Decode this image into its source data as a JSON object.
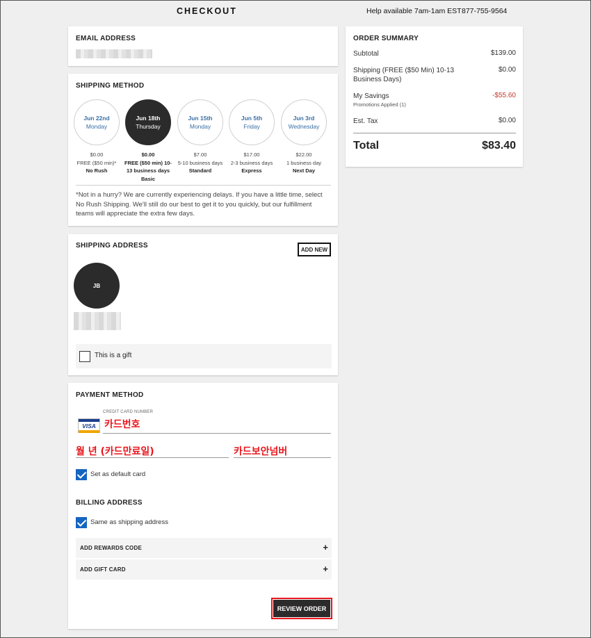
{
  "header": {
    "title": "CHECKOUT",
    "help_text": "Help available 7am-1am EST",
    "phone": "877-755-9564"
  },
  "email": {
    "title": "EMAIL ADDRESS"
  },
  "shipping_method": {
    "title": "SHIPPING METHOD",
    "options": [
      {
        "date": "Jun 22nd",
        "day": "Monday",
        "price": "$0.00",
        "desc": "FREE ($50 min)*",
        "name": "No Rush",
        "selected": false
      },
      {
        "date": "Jun 18th",
        "day": "Thursday",
        "price": "$0.00",
        "desc": "FREE ($50 min) 10-13 business days",
        "name": "Basic",
        "selected": true
      },
      {
        "date": "Jun 15th",
        "day": "Monday",
        "price": "$7.00",
        "desc": "5-10 business days",
        "name": "Standard",
        "selected": false
      },
      {
        "date": "Jun 5th",
        "day": "Friday",
        "price": "$17.00",
        "desc": "2-3 business days",
        "name": "Express",
        "selected": false
      },
      {
        "date": "Jun 3rd",
        "day": "Wednesday",
        "price": "$22.00",
        "desc": "1 business day",
        "name": "Next Day",
        "selected": false
      }
    ],
    "note": "*Not in a hurry? We are currently experiencing delays. If you have a little time, select No Rush Shipping. We'll still do our best to get it to you quickly, but our fulfillment teams will appreciate the extra few days."
  },
  "shipping_address": {
    "title": "SHIPPING ADDRESS",
    "add_new": "ADD NEW",
    "avatar_initials": "JB",
    "gift_label": "This is a gift",
    "gift_checked": false
  },
  "payment": {
    "title": "PAYMENT METHOD",
    "card_number_label": "CREDIT CARD NUMBER",
    "card_brand": "VISA",
    "card_number_value": "카드번호",
    "expiry_value": "월 년 (카드만료일)",
    "cvv_value": "카드보안넘버",
    "default_card_label": "Set as default card",
    "default_card_checked": true
  },
  "billing": {
    "title": "BILLING ADDRESS",
    "same_as_shipping_label": "Same as shipping address",
    "same_as_shipping_checked": true,
    "rewards_label": "ADD REWARDS CODE",
    "gift_card_label": "ADD GIFT CARD",
    "expand_symbol": "+",
    "review_button": "REVIEW ORDER"
  },
  "order_summary": {
    "title": "ORDER SUMMARY",
    "subtotal_label": "Subtotal",
    "subtotal_value": "$139.00",
    "shipping_label": "Shipping (FREE ($50 Min) 10-13 Business Days)",
    "shipping_value": "$0.00",
    "savings_label": "My Savings",
    "savings_sub": "Promotions Applied (1)",
    "savings_value": "-$55.60",
    "tax_label": "Est. Tax",
    "tax_value": "$0.00",
    "total_label": "Total",
    "total_value": "$83.40"
  },
  "colors": {
    "accent_checkbox": "#1565c0",
    "selected_circle": "#2b2b2b",
    "date_text": "#3a6ea5",
    "savings_red": "#c0392b",
    "annotation_red": "#e8151b"
  }
}
